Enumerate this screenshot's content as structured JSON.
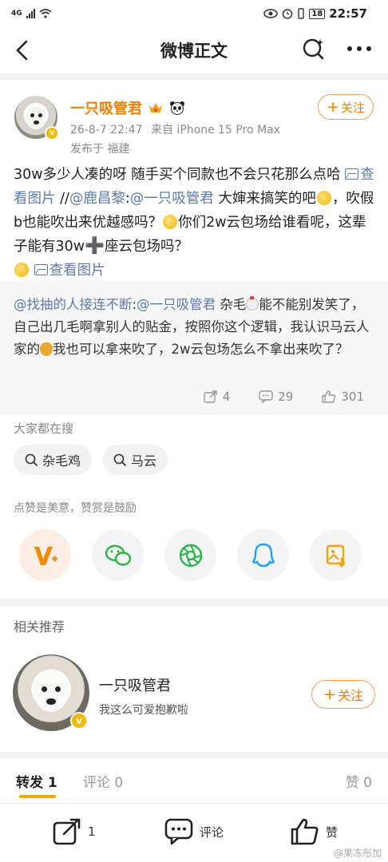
{
  "status_bar": {
    "network": "4G",
    "battery": "18",
    "time": "22:57"
  },
  "header": {
    "title": "微博正文"
  },
  "post": {
    "username": "一只吸管君",
    "timestamp": "26-8-7 22:47",
    "device": "来自 iPhone 15 Pro Max",
    "location": "发布于 福建",
    "follow_label": "关注",
    "text_line1": "30w多少人凑的呀 随手买个同款也不会只花那么点哈 ",
    "view_pic1": "查看图片",
    "rt_prefix": " //",
    "rt_user": "@鹿昌黎",
    "rt_sep": ":",
    "rt_mention": "@一只吸管君",
    "text_line2": " 大婶来搞笑的吧",
    "text_line3": "，吹假b也能吹出来优越感吗？",
    "text_line4": "你们2w云包场给谁看呢，这辈子能有30w",
    "text_line5": "座云包场吗？",
    "view_pic2": "查看图片"
  },
  "repost": {
    "user": "@找抽的人接连不断",
    "sep": ":",
    "mention": "@一只吸管君",
    "text1": " 杂毛",
    "text2": "能不能别发笑了，自己出几毛啊拿别人的贴金，按照你这个逻辑，我认识马云人家的",
    "text3": "我也可以拿来吹了，2w云包场怎么不拿出来吹了？",
    "reposts": "4",
    "comments": "29",
    "likes": "301"
  },
  "search": {
    "label": "大家都在搜",
    "tags": [
      "杂毛鸡",
      "马云"
    ]
  },
  "reward": {
    "label": "点赞是美意，赞赏是鼓励"
  },
  "recommend": {
    "label": "相关推荐",
    "name": "一只吸管君",
    "desc": "我这么可爱抱歉啦",
    "follow_label": "关注"
  },
  "tabs": {
    "repost": "转发 1",
    "comment": "评论 0",
    "like": "赞 0"
  },
  "bottom_bar": {
    "share_count": "1",
    "comment_label": "评论",
    "like_label": "赞"
  },
  "watermark": "@果冻彤加",
  "colors": {
    "accent": "#f07e00",
    "link": "#5b7aa9",
    "underline": "#f7a500"
  }
}
